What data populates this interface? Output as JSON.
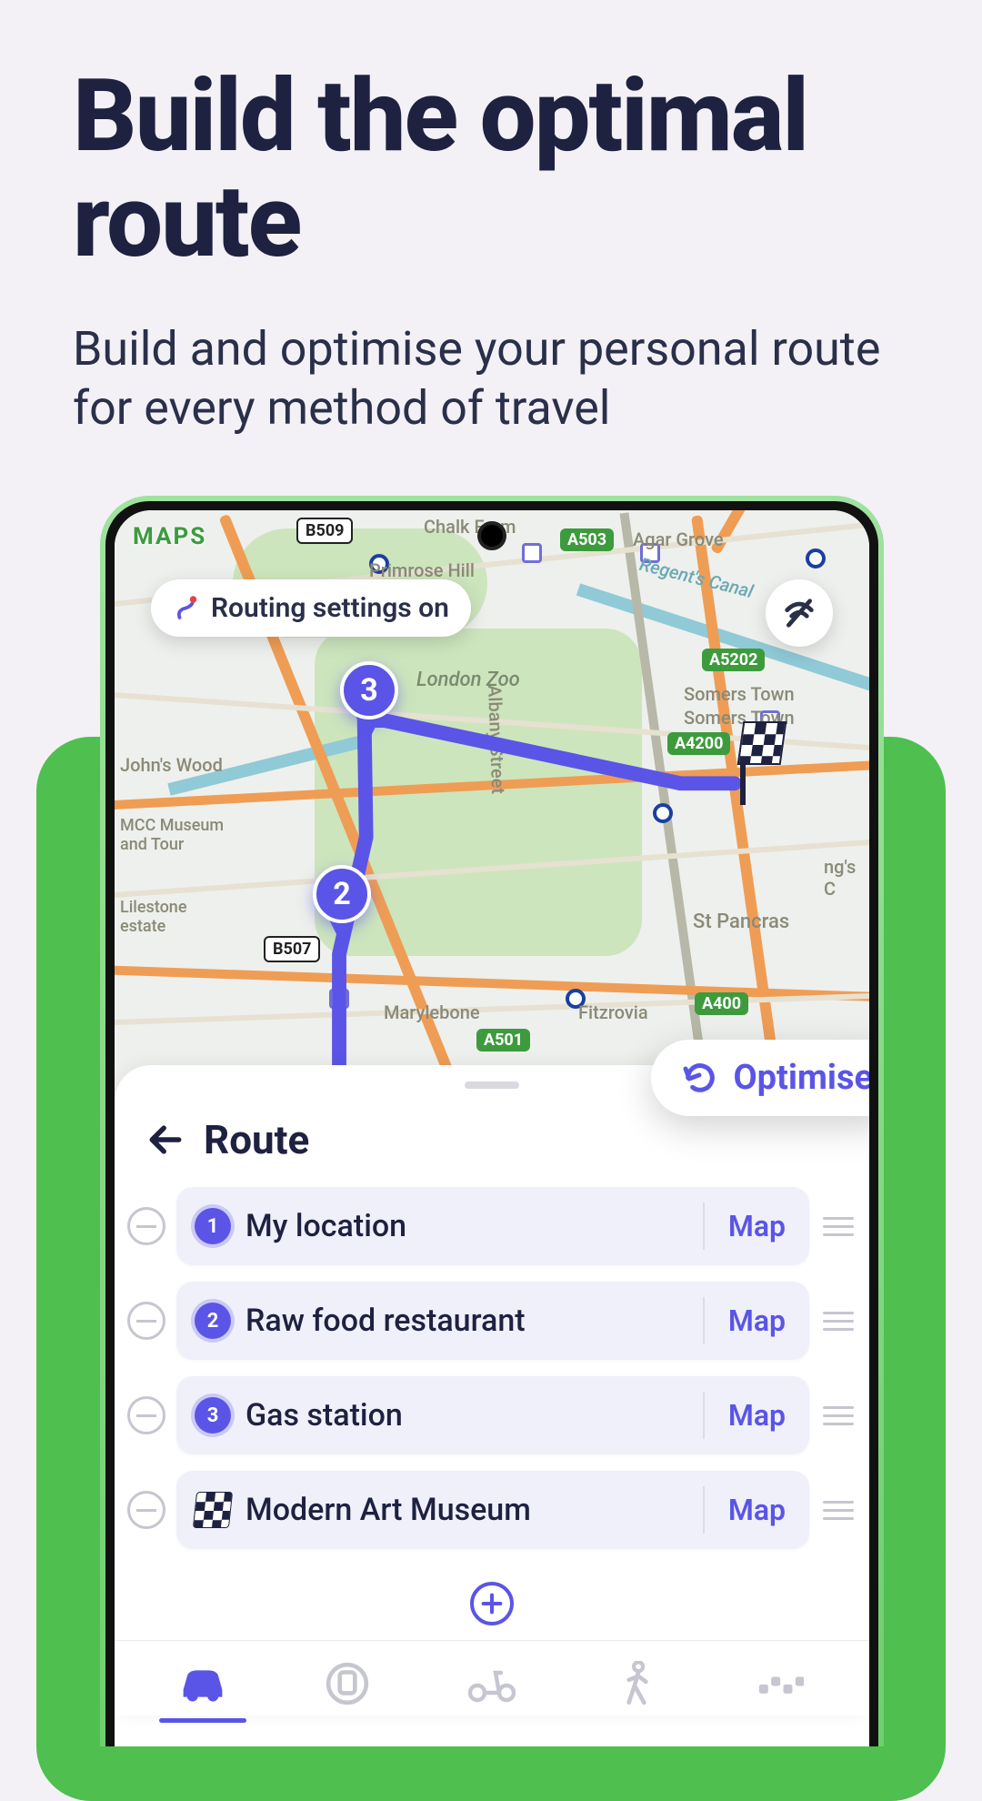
{
  "hero": {
    "title": "Build the optimal route",
    "subtitle": "Build and optimise your personal route for every method of travel"
  },
  "map": {
    "status_left": "MAPS",
    "settings_chip": "Routing settings on",
    "labels": {
      "primrose": "Primrose Hill",
      "zoo": "London Zoo",
      "johns": "John's Wood",
      "mcc": "MCC Museum and Tour",
      "lilestone": "Lilestone estate",
      "albany": "Albany Street",
      "somers1": "Somers Town",
      "somers2": "Somers Town",
      "stpancras": "St Pancras",
      "fitzrovia": "Fitzrovia",
      "marylebone": "Marylebone",
      "agar": "Agar Grove",
      "chalkfarm": "Chalk Farm",
      "ngs": "ng's C",
      "canal": "Regent's Canal"
    },
    "roads": {
      "a503": "A503",
      "a5202": "A5202",
      "a4200": "A4200",
      "a400": "A400",
      "a501": "A501",
      "b509": "B509",
      "b507": "B507"
    },
    "waypoints": {
      "w2": "2",
      "w3": "3"
    }
  },
  "sheet": {
    "title": "Route",
    "optimise": "Optimise",
    "map_action": "Map",
    "stops": [
      {
        "idx": "1",
        "name": "My location"
      },
      {
        "idx": "2",
        "name": "Raw food restaurant"
      },
      {
        "idx": "3",
        "name": "Gas station"
      },
      {
        "idx": "finish",
        "name": "Modern Art Museum"
      }
    ]
  }
}
